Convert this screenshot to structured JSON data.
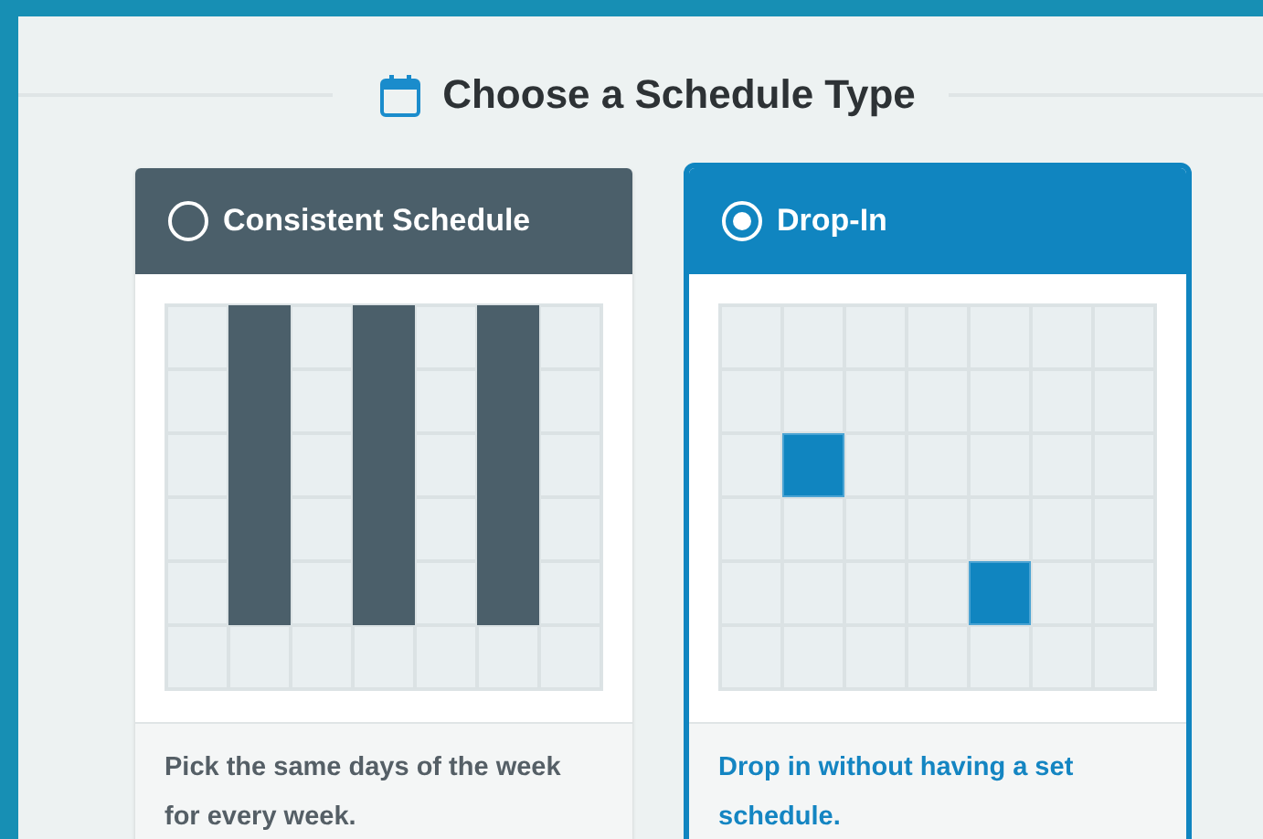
{
  "heading": {
    "title": "Choose a Schedule Type"
  },
  "options": [
    {
      "title": "Consistent Schedule",
      "selected": false,
      "description": "Pick the same days of the week for every week.",
      "cells": [
        [
          false,
          true,
          false,
          true,
          false,
          true,
          false
        ],
        [
          false,
          true,
          false,
          true,
          false,
          true,
          false
        ],
        [
          false,
          true,
          false,
          true,
          false,
          true,
          false
        ],
        [
          false,
          true,
          false,
          true,
          false,
          true,
          false
        ],
        [
          false,
          true,
          false,
          true,
          false,
          true,
          false
        ],
        [
          false,
          false,
          false,
          false,
          false,
          false,
          false
        ]
      ]
    },
    {
      "title": "Drop-In",
      "selected": true,
      "description": "Drop in without having a set schedule.",
      "cells": [
        [
          false,
          false,
          false,
          false,
          false,
          false,
          false
        ],
        [
          false,
          false,
          false,
          false,
          false,
          false,
          false
        ],
        [
          false,
          true,
          false,
          false,
          false,
          false,
          false
        ],
        [
          false,
          false,
          false,
          false,
          false,
          false,
          false
        ],
        [
          false,
          false,
          false,
          false,
          true,
          false,
          false
        ],
        [
          false,
          false,
          false,
          false,
          false,
          false,
          false
        ]
      ]
    }
  ]
}
